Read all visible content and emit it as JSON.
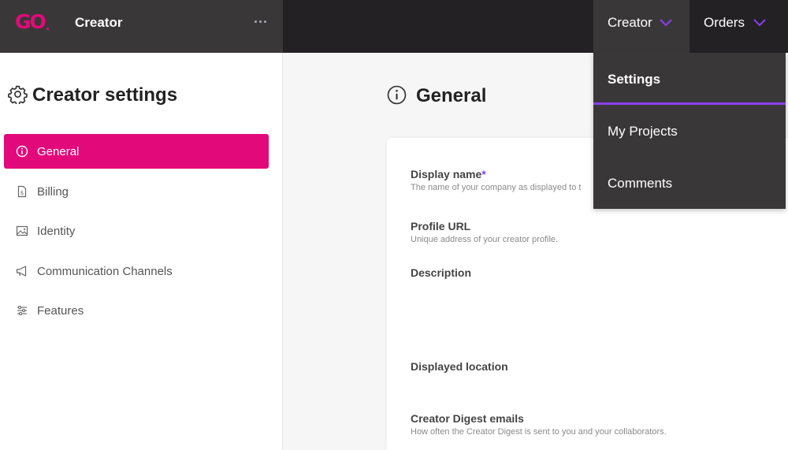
{
  "header": {
    "logo_text": "GO",
    "app_title": "Creator",
    "more_icon": "ellipsis-icon",
    "nav": [
      {
        "label": "Creator",
        "icon": "chevron-down-icon"
      },
      {
        "label": "Orders",
        "icon": "chevron-down-icon"
      }
    ],
    "accent_color": "#8a3ff0",
    "brand_color": "#e20a7a"
  },
  "dropdown": {
    "items": [
      {
        "label": "Settings",
        "active": true
      },
      {
        "label": "My Projects",
        "active": false
      },
      {
        "label": "Comments",
        "active": false
      }
    ]
  },
  "sidebar": {
    "title": "Creator settings",
    "title_icon": "gear-icon",
    "items": [
      {
        "label": "General",
        "icon": "info-icon",
        "active": true
      },
      {
        "label": "Billing",
        "icon": "invoice-icon",
        "active": false
      },
      {
        "label": "Identity",
        "icon": "image-icon",
        "active": false
      },
      {
        "label": "Communication Channels",
        "icon": "megaphone-icon",
        "active": false
      },
      {
        "label": "Features",
        "icon": "sliders-icon",
        "active": false
      }
    ]
  },
  "main": {
    "title": "General",
    "title_icon": "info-icon",
    "fields": [
      {
        "label": "Display name",
        "required_mark": "*",
        "help": "The name of your company as displayed to t"
      },
      {
        "label": "Profile URL",
        "help": "Unique address of your creator profile."
      },
      {
        "label": "Description"
      },
      {
        "label": "Displayed location"
      },
      {
        "label": "Creator Digest emails",
        "help": "How often the Creator Digest is sent to you and your collaborators."
      }
    ]
  }
}
